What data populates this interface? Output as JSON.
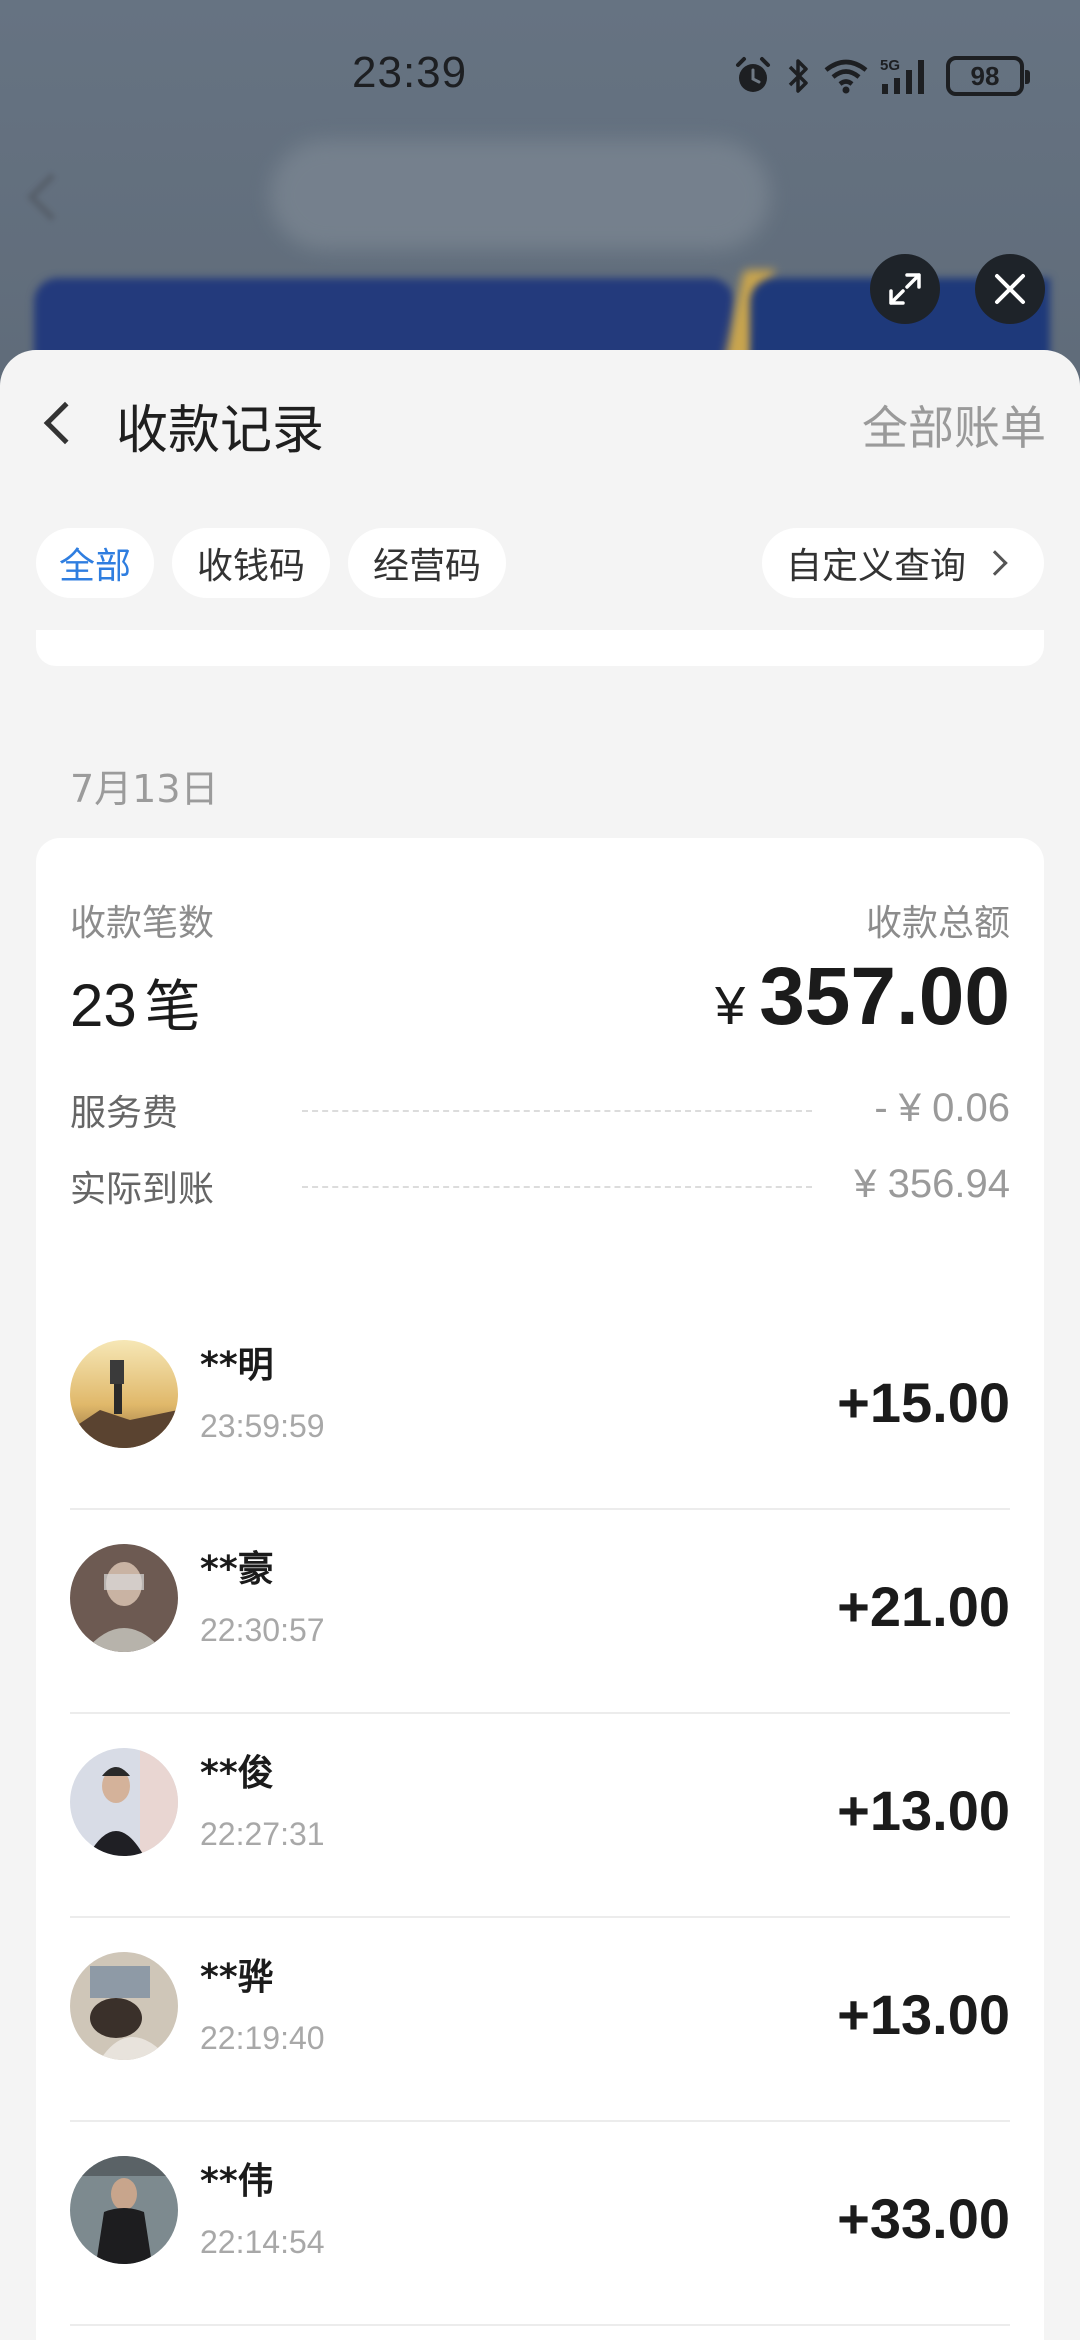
{
  "status_bar": {
    "time": "23:39",
    "battery": "98",
    "icons": [
      "alarm-icon",
      "bluetooth-icon",
      "wifi-icon",
      "5g-signal-icon",
      "battery-icon"
    ]
  },
  "overlay_buttons": [
    "expand-icon",
    "close-icon"
  ],
  "nav": {
    "title": "收款记录",
    "right_link": "全部账单"
  },
  "filters": {
    "all": "全部",
    "collect_code": "收钱码",
    "business_code": "经营码",
    "custom_query": "自定义查询",
    "active": "全部"
  },
  "summary": {
    "date": "7月13日",
    "count_label": "收款笔数",
    "count_value": "23",
    "count_unit": "笔",
    "total_label": "收款总额",
    "currency": "¥",
    "total_value": "357.00",
    "fee_label": "服务费",
    "fee_value": "- ¥ 0.06",
    "net_label": "实际到账",
    "net_value": "¥ 356.94"
  },
  "transactions": [
    {
      "name": "**明",
      "time": "23:59:59",
      "amount": "+15.00"
    },
    {
      "name": "**豪",
      "time": "22:30:57",
      "amount": "+21.00"
    },
    {
      "name": "**俊",
      "time": "22:27:31",
      "amount": "+13.00"
    },
    {
      "name": "**骅",
      "time": "22:19:40",
      "amount": "+13.00"
    },
    {
      "name": "**伟",
      "time": "22:14:54",
      "amount": "+33.00"
    }
  ],
  "colors": {
    "accent": "#2f7ee0",
    "sheet_bg": "#f4f4f4",
    "card_bg": "#ffffff"
  }
}
